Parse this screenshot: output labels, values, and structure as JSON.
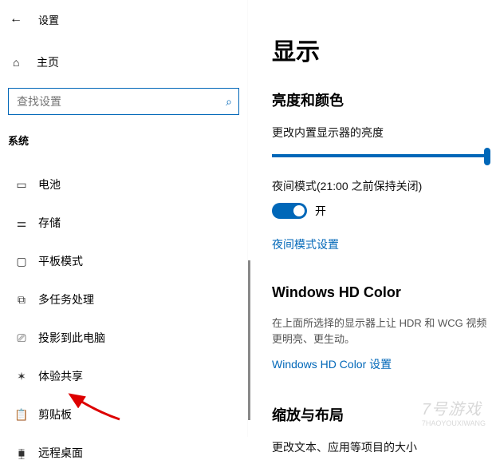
{
  "header": {
    "title": "设置"
  },
  "home": {
    "label": "主页"
  },
  "search": {
    "placeholder": "查找设置"
  },
  "section": {
    "label": "系统"
  },
  "nav": [
    {
      "icon_name": "battery-icon",
      "glyph": "▭",
      "label": "电池"
    },
    {
      "icon_name": "storage-icon",
      "glyph": "⚌",
      "label": "存储"
    },
    {
      "icon_name": "tablet-icon",
      "glyph": "▢",
      "label": "平板模式"
    },
    {
      "icon_name": "multitask-icon",
      "glyph": "⧉",
      "label": "多任务处理"
    },
    {
      "icon_name": "project-icon",
      "glyph": "⎚",
      "label": "投影到此电脑"
    },
    {
      "icon_name": "share-icon",
      "glyph": "✶",
      "label": "体验共享"
    },
    {
      "icon_name": "clipboard-icon",
      "glyph": "📋",
      "label": "剪贴板"
    },
    {
      "icon_name": "remote-icon",
      "glyph": "⧯",
      "label": "远程桌面"
    }
  ],
  "page": {
    "title": "显示",
    "section1": {
      "heading": "亮度和颜色",
      "brightness_label": "更改内置显示器的亮度",
      "night_mode_label": "夜间模式(21:00 之前保持关闭)",
      "toggle_state": "开",
      "night_mode_link": "夜间模式设置"
    },
    "section2": {
      "heading": "Windows HD Color",
      "desc": "在上面所选择的显示器上让 HDR 和 WCG 视频更明亮、更生动。",
      "link": "Windows HD Color 设置"
    },
    "section3": {
      "heading": "缩放与布局",
      "desc": "更改文本、应用等项目的大小"
    }
  },
  "watermark": {
    "main": "7号游戏",
    "sub": "7HAOYOUXIWANG"
  }
}
